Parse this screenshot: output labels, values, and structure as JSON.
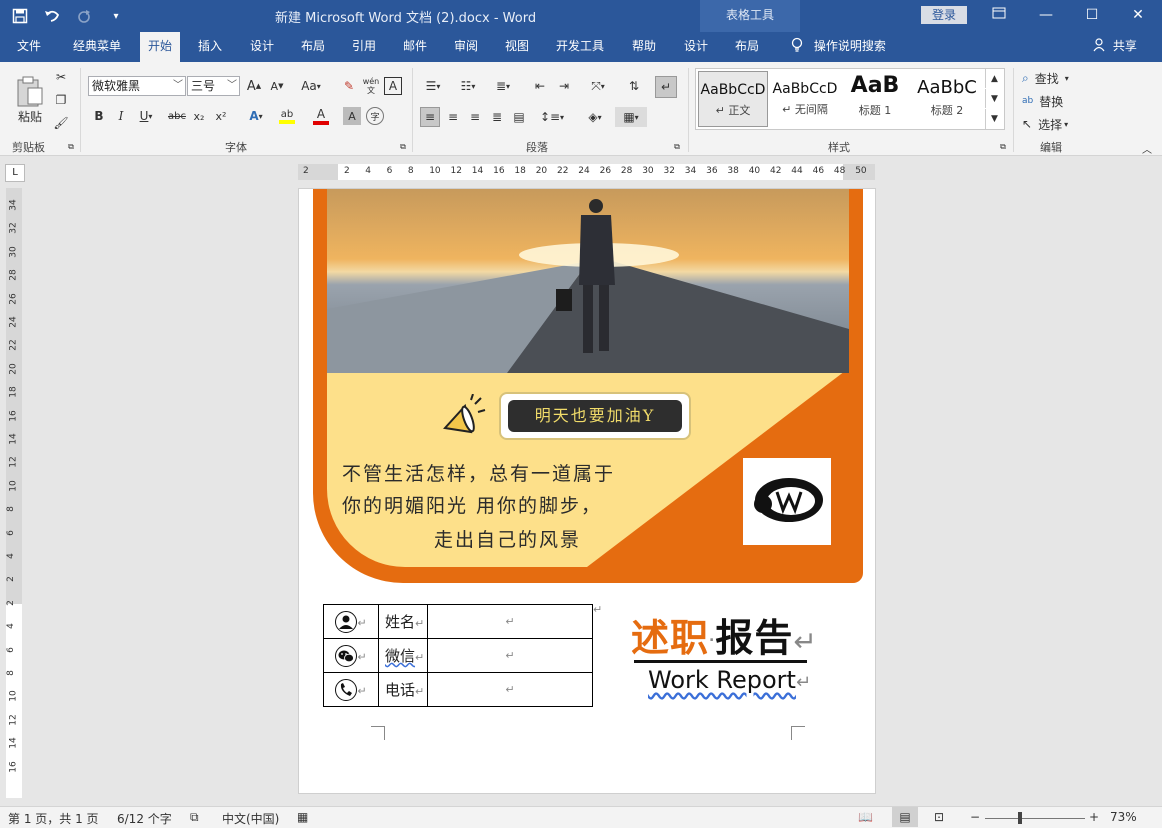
{
  "titlebar": {
    "doc_title": "新建 Microsoft Word 文档 (2).docx  -  Word",
    "context_tab": "表格工具",
    "login": "登录",
    "icons": {
      "save": "save-icon",
      "undo": "undo-icon",
      "redo": "redo-icon",
      "customize": "qat-dropdown-icon"
    },
    "window_controls": {
      "ribbon_display": "ribbon-display-icon",
      "minimize": "minimize-icon",
      "maximize": "maximize-icon",
      "close": "close-icon"
    }
  },
  "tabs": [
    {
      "label": "文件"
    },
    {
      "label": "经典菜单"
    },
    {
      "label": "开始",
      "active": true
    },
    {
      "label": "插入"
    },
    {
      "label": "设计"
    },
    {
      "label": "布局"
    },
    {
      "label": "引用"
    },
    {
      "label": "邮件"
    },
    {
      "label": "审阅"
    },
    {
      "label": "视图"
    },
    {
      "label": "开发工具"
    },
    {
      "label": "帮助"
    },
    {
      "label": "设计"
    },
    {
      "label": "布局"
    }
  ],
  "tellme": "操作说明搜索",
  "share": "共享",
  "ribbon": {
    "clipboard": {
      "label": "剪贴板",
      "paste": "粘贴"
    },
    "font": {
      "label": "字体",
      "font_name": "微软雅黑",
      "font_size": "三号",
      "buttons": {
        "bold": "B",
        "italic": "I",
        "underline": "U",
        "strike": "abc",
        "subscript": "x₂",
        "superscript": "x²",
        "change_case": "Aa",
        "wen": "wén 文"
      }
    },
    "paragraph": {
      "label": "段落"
    },
    "styles": {
      "label": "样式",
      "items": [
        {
          "sample": "AaBbCcD",
          "name": "↵ 正文"
        },
        {
          "sample": "AaBbCcD",
          "name": "↵ 无间隔"
        },
        {
          "sample": "AaB",
          "name": "标题 1"
        },
        {
          "sample": "AaBbC",
          "name": "标题 2"
        }
      ]
    },
    "editing": {
      "label": "编辑",
      "find": "查找",
      "replace": "替换",
      "select": "选择"
    }
  },
  "hruler_numbers": [
    "2",
    "2",
    "4",
    "6",
    "8",
    "10",
    "12",
    "14",
    "16",
    "18",
    "20",
    "22",
    "24",
    "26",
    "28",
    "30",
    "32",
    "34",
    "36",
    "38",
    "40",
    "42",
    "44",
    "46",
    "48",
    "50"
  ],
  "vruler_numbers": [
    "34",
    "32",
    "30",
    "28",
    "26",
    "24",
    "22",
    "20",
    "18",
    "16",
    "14",
    "12",
    "10",
    "8",
    "6",
    "4",
    "2",
    "2",
    "4",
    "6",
    "8",
    "10",
    "12",
    "14",
    "16"
  ],
  "document": {
    "badge_text": "明天也要加油Y",
    "poem": [
      "不管生活怎样，总有一道属于",
      "你的明媚阳光  用你的脚步，",
      "走出自己的风景"
    ],
    "table": [
      {
        "icon": "person-icon",
        "label": "姓名",
        "value": "↵"
      },
      {
        "icon": "wechat-icon",
        "label": "微信",
        "value": "↵"
      },
      {
        "icon": "phone-icon",
        "label": "电话",
        "value": "↵"
      }
    ],
    "title_orange": "述职",
    "title_black": "报告",
    "para_mark": "↵",
    "subtitle": "Work Report"
  },
  "statusbar": {
    "page": "第 1 页，共 1 页",
    "words": "6/12 个字",
    "language": "中文(中国)",
    "zoom": "73%",
    "zoom_minus": "−",
    "zoom_plus": "+"
  }
}
